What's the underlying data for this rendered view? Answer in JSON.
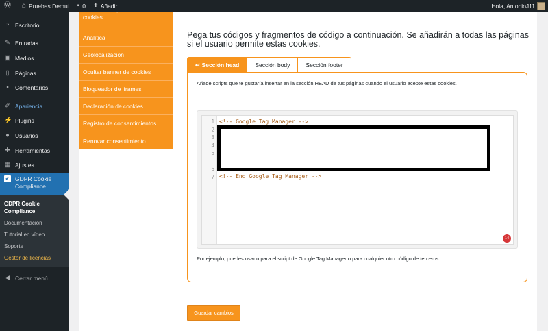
{
  "adminbar": {
    "site_name": "Pruebas Demui",
    "comments_count": "0",
    "new_label": "Añadir",
    "greeting": "Hola, AntonioJ11"
  },
  "sidebar": {
    "items": [
      {
        "label": "Escritorio",
        "icon": "dashboard-icon"
      },
      {
        "label": "Entradas",
        "icon": "pin-icon"
      },
      {
        "label": "Medios",
        "icon": "media-icon"
      },
      {
        "label": "Páginas",
        "icon": "pages-icon"
      },
      {
        "label": "Comentarios",
        "icon": "comments-icon"
      },
      {
        "label": "Apariencia",
        "icon": "brush-icon"
      },
      {
        "label": "Plugins",
        "icon": "plugin-icon"
      },
      {
        "label": "Usuarios",
        "icon": "users-icon"
      },
      {
        "label": "Herramientas",
        "icon": "tools-icon"
      },
      {
        "label": "Ajustes",
        "icon": "settings-icon"
      }
    ],
    "active": {
      "label": "GDPR Cookie Compliance",
      "icon": "checkbox-icon"
    },
    "submenu": [
      "GDPR Cookie Compliance",
      "Documentación",
      "Tutorial en vídeo",
      "Soporte",
      "Gestor de licencias"
    ],
    "collapse_label": "Cerrar menú"
  },
  "orange_nav": {
    "items": [
      "Pantalla completa / Muro de cookies",
      "Analítica",
      "Geolocalización",
      "Ocultar banner de cookies",
      "Bloqueador de iframes",
      "Declaración de cookies",
      "Registro de consentimientos",
      "Renovar consentimiento"
    ]
  },
  "main": {
    "heading": "Pega tus códigos y fragmentos de código a continuación. Se añadirán a todas las páginas si el usuario permite estas cookies.",
    "tabs": [
      "Sección head",
      "Sección body",
      "Sección footer"
    ],
    "description": "Añade scripts que te gustaría insertar en la sección HEAD de tus páginas cuando el usuario acepte estas cookies.",
    "code": {
      "line_numbers": [
        "1",
        "2",
        "3",
        "4",
        "5",
        "6",
        "7"
      ],
      "first_line": "<!-- Google Tag Manager -->",
      "last_line": "<!-- End Google Tag Manager -->",
      "error_count": "14"
    },
    "hint": "Por ejemplo, puedes usarlo para el script de Google Tag Manager o para cualquier otro código de terceros.",
    "save_label": "Guardar cambios"
  },
  "colors": {
    "accent": "#f7941d",
    "admin_dark": "#1d2327",
    "active_blue": "#2271b1",
    "error_red": "#d63638"
  }
}
